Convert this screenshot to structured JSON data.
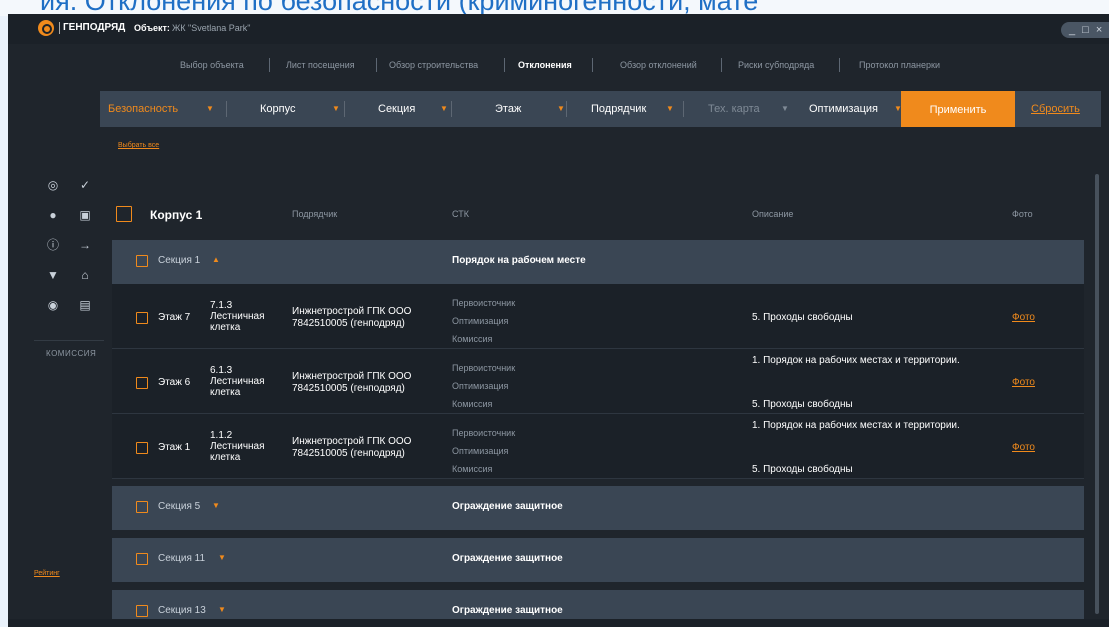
{
  "page_top_text": "ия. Отклонения по безопасности (криминогенности, мате",
  "titlebar": {
    "brand": "ГЕНПОДРЯД",
    "object_label": "Объект:",
    "object_value": "ЖК \"Svetlana Park\"",
    "window_controls": "_ □ ×"
  },
  "nav": {
    "tabs": [
      "Выбор объекта",
      "Лист посещения",
      "Обзор строительства",
      "Отклонения",
      "Обзор отклонений",
      "Риски субподряда",
      "Протокол планерки"
    ]
  },
  "filters": {
    "items": [
      "Безопасность",
      "Корпус",
      "Секция",
      "Этаж",
      "Подрядчик",
      "Тех. карта",
      "Оптимизация"
    ],
    "apply_label": "Применить",
    "reset_label": "Сбросить",
    "select_all": "Выбрать все"
  },
  "sidebar": {
    "label": "КОМИССИЯ",
    "rating_link": "Рейтинг"
  },
  "table": {
    "title": "Корпус 1",
    "columns": {
      "contractor": "Подрядчик",
      "stk": "СТК",
      "description": "Описание",
      "photo": "Фото"
    },
    "sections": [
      {
        "name": "Секция 1",
        "arrow": "▲",
        "desc": "Порядок на рабочем месте"
      },
      {
        "name": "Секция 5",
        "arrow": "▼",
        "desc": "Ограждение защитное"
      },
      {
        "name": "Секция 11",
        "arrow": "▼",
        "desc": "Ограждение защитное"
      },
      {
        "name": "Секция 13",
        "arrow": "▼",
        "desc": "Ограждение защитное"
      }
    ],
    "rows": [
      {
        "floor": "Этаж 7",
        "loc_code": "7.1.3",
        "loc_name": "Лестничная клетка",
        "contractor1": "Инжнетрострой ГПК ООО",
        "contractor2": "7842510005 (генподряд)",
        "stk": [
          "Первоисточник",
          "Оптимизация",
          "Комиссия"
        ],
        "desc1": "",
        "desc2": "5. Проходы свободны",
        "photo": "Фото"
      },
      {
        "floor": "Этаж 6",
        "loc_code": "6.1.3",
        "loc_name": "Лестничная клетка",
        "contractor1": "Инжнетрострой ГПК ООО",
        "contractor2": "7842510005 (генподряд)",
        "stk": [
          "Первоисточник",
          "Оптимизация",
          "Комиссия"
        ],
        "desc1": "1. Порядок на рабочих местах и территории.",
        "desc2": "5. Проходы свободны",
        "photo": "Фото"
      },
      {
        "floor": "Этаж 1",
        "loc_code": "1.1.2",
        "loc_name": "Лестничная клетка",
        "contractor1": "Инжнетрострой ГПК ООО",
        "contractor2": "7842510005 (генподряд)",
        "stk": [
          "Первоисточник",
          "Оптимизация",
          "Комиссия"
        ],
        "desc1": "1. Порядок на рабочих местах и территории.",
        "desc2": "5. Проходы свободны",
        "photo": "Фото"
      }
    ]
  },
  "colors": {
    "accent": "#f08a1c",
    "bg": "#1f252c",
    "panel": "#3a4654"
  }
}
